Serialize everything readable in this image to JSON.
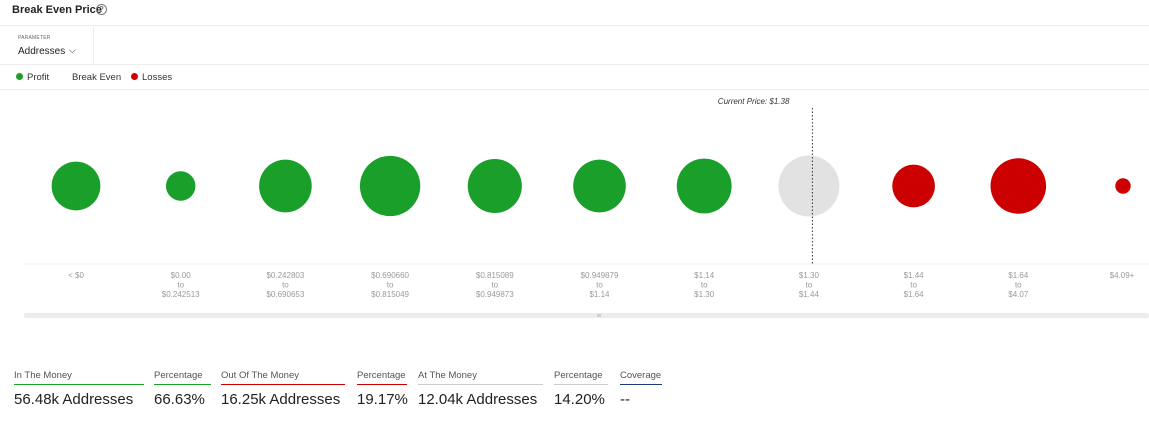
{
  "header": {
    "title": "Break Even Price",
    "help_icon": "question-circle-icon"
  },
  "parameter": {
    "label": "PARAMETER",
    "value": "Addresses",
    "icon": "chevron-down-icon"
  },
  "legend": [
    {
      "label": "Profit",
      "color": "#1a9f2a"
    },
    {
      "label": "Break Even",
      "color": ""
    },
    {
      "label": "Losses",
      "color": "#cc0000"
    }
  ],
  "colors": {
    "profit": "#1a9f2a",
    "even": "#e2e2e2",
    "losses": "#cc0000"
  },
  "chart_data": {
    "type": "bubble",
    "current_price_label": "Current Price: $1.38",
    "current_price": 1.38,
    "categories": [
      {
        "lines": [
          "< $0"
        ],
        "value": 30,
        "status": "profit"
      },
      {
        "lines": [
          "$0.00",
          "to",
          "$0.242513"
        ],
        "value": 11,
        "status": "profit"
      },
      {
        "lines": [
          "$0.242803",
          "to",
          "$0.690653"
        ],
        "value": 35,
        "status": "profit"
      },
      {
        "lines": [
          "$0.690660",
          "to",
          "$0.815049"
        ],
        "value": 46,
        "status": "profit"
      },
      {
        "lines": [
          "$0.815089",
          "to",
          "$0.949873"
        ],
        "value": 37,
        "status": "profit"
      },
      {
        "lines": [
          "$0.949879",
          "to",
          "$1.14"
        ],
        "value": 35,
        "status": "profit"
      },
      {
        "lines": [
          "$1.14",
          "to",
          "$1.30"
        ],
        "value": 38,
        "status": "profit"
      },
      {
        "lines": [
          "$1.30",
          "to",
          "$1.44"
        ],
        "value": 47,
        "status": "even"
      },
      {
        "lines": [
          "$1.44",
          "to",
          "$1.64"
        ],
        "value": 23,
        "status": "losses"
      },
      {
        "lines": [
          "$1.64",
          "to",
          "$4.07"
        ],
        "value": 39,
        "status": "losses"
      },
      {
        "lines": [
          "$4.09+"
        ],
        "value": 3,
        "status": "losses"
      }
    ]
  },
  "stats": [
    {
      "label": "In The Money",
      "value": "56.48k Addresses",
      "color": "#1a9f2a"
    },
    {
      "label": "Percentage",
      "value": "66.63%",
      "color": "#1a9f2a"
    },
    {
      "label": "Out Of The Money",
      "value": "16.25k Addresses",
      "color": "#cc0000"
    },
    {
      "label": "Percentage",
      "value": "19.17%",
      "color": "#cc0000"
    },
    {
      "label": "At The Money",
      "value": "12.04k Addresses",
      "color": "#cccccc"
    },
    {
      "label": "Percentage",
      "value": "14.20%",
      "color": "#cccccc"
    },
    {
      "label": "Coverage",
      "value": "--",
      "color": "#1f3b73"
    }
  ]
}
